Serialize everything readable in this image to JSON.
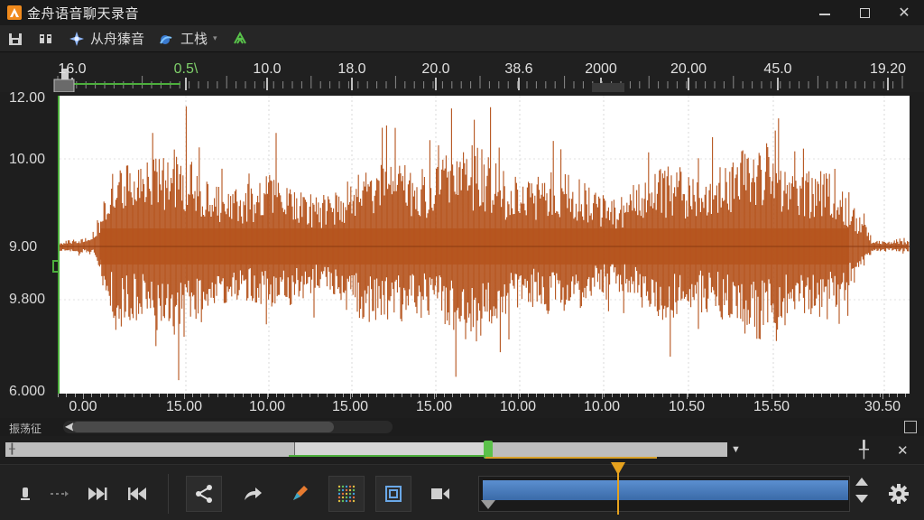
{
  "window": {
    "title": "金舟语音聊天录音",
    "close_glyph": "✕"
  },
  "toolbar": {
    "items": [
      {
        "name": "save",
        "icon": "save-icon"
      },
      {
        "name": "record-settings",
        "icon": "device-icon"
      },
      {
        "name": "from-boat",
        "icon": "spark-icon",
        "label": "从舟獉音"
      },
      {
        "name": "tools",
        "icon": "wrench-icon",
        "label": "工栈",
        "caret": "▾"
      },
      {
        "name": "effects",
        "icon": "leaf-icon"
      }
    ]
  },
  "ruler": {
    "labels": [
      "16.0",
      "0.5\\",
      "10.0",
      "18.0",
      "20.0",
      "38.6",
      "2000",
      "20.00",
      "45.0",
      "19.20"
    ]
  },
  "y_axis": {
    "labels": [
      "12.00",
      "10.00",
      "9.00",
      "9.800",
      "6.000"
    ]
  },
  "x_axis": {
    "labels": [
      "0.00",
      "15.00",
      "10.00",
      "15.00",
      "15.00",
      "10.00",
      "10.00",
      "10.50",
      "15.50",
      "30.50"
    ]
  },
  "scroll": {
    "label": "振荡征",
    "left_arrow": "◀"
  },
  "overview": {
    "caret": "▼",
    "tool_pin": "╀",
    "tool_close": "✕"
  },
  "waveform": {
    "color": "#b5531c",
    "background": "#ffffff"
  },
  "colors": {
    "accent_green": "#4cae3c",
    "playhead_orange": "#e6a21e",
    "timeline_blue": "#4a7fc0"
  }
}
